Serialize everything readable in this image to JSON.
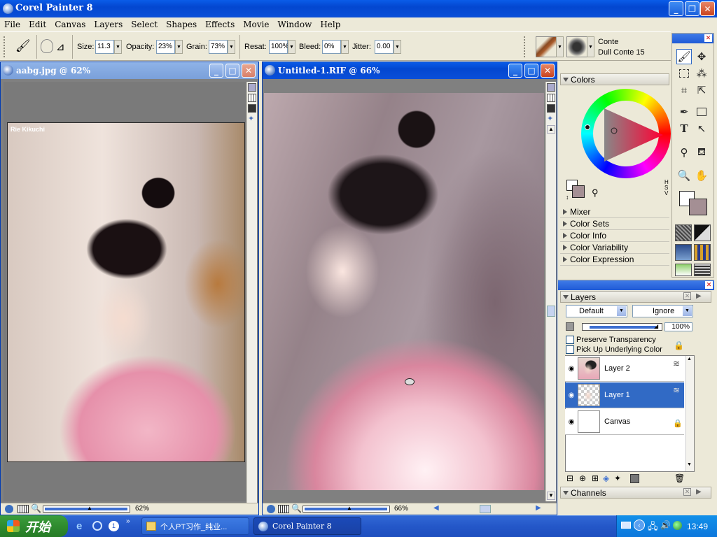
{
  "app": {
    "title": "Corel Painter 8"
  },
  "menu": [
    "File",
    "Edit",
    "Canvas",
    "Layers",
    "Select",
    "Shapes",
    "Effects",
    "Movie",
    "Window",
    "Help"
  ],
  "toolbar": {
    "size_label": "Size:",
    "size_value": "11.3",
    "opacity_label": "Opacity:",
    "opacity_value": "23%",
    "grain_label": "Grain:",
    "grain_value": "73%",
    "resat_label": "Resat:",
    "resat_value": "100%",
    "bleed_label": "Bleed:",
    "bleed_value": "0%",
    "jitter_label": "Jitter:",
    "jitter_value": "0.00",
    "brush_category": "Conte",
    "brush_variant": "Dull Conte 15"
  },
  "doc1": {
    "title": "aabg.jpg @ 62%",
    "zoom": "62%",
    "watermark": "Rie Kikuchi"
  },
  "doc2": {
    "title": "Untitled-1.RIF @ 66%",
    "zoom": "66%"
  },
  "colors_panel": {
    "title": "Colors",
    "hsv_label": "HSV",
    "sections": [
      "Mixer",
      "Color Sets",
      "Color Info",
      "Color Variability",
      "Color Expression"
    ]
  },
  "layers_panel": {
    "title": "Layers",
    "composite_method": "Default",
    "depth_mode": "Ignore",
    "opacity": "100%",
    "preserve_transparency": "Preserve Transparency",
    "pick_up_underlying": "Pick Up Underlying Color",
    "layers": [
      {
        "name": "Layer 2",
        "selected": false
      },
      {
        "name": "Layer 1",
        "selected": true
      },
      {
        "name": "Canvas",
        "selected": false
      }
    ],
    "channels_label": "Channels"
  },
  "taskbar": {
    "start_label": "开始",
    "items": [
      "个人PT习作_纯业...",
      "Corel Painter 8"
    ],
    "clock": "13:49",
    "quicklaunch_badge": "1"
  },
  "colors": {
    "xp_blue": "#0a5ce8",
    "selection": "#316ac5",
    "secondary_swatch": "#a48f94"
  }
}
